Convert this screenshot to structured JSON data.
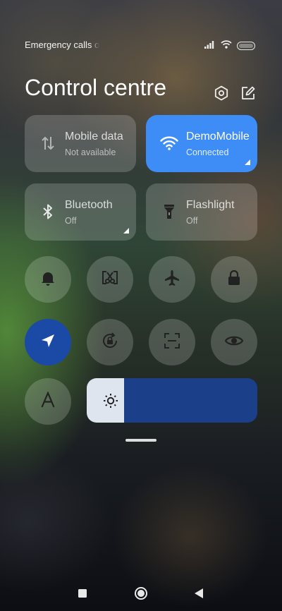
{
  "status_bar": {
    "carrier_text": "Emergency calls only",
    "icons": [
      "signal-icon",
      "wifi-icon",
      "battery-icon"
    ]
  },
  "header": {
    "title": "Control centre",
    "icons": [
      "settings-icon",
      "edit-icon"
    ]
  },
  "tiles": [
    {
      "label": "Mobile data",
      "status": "Not available",
      "icon": "mobile-data-icon",
      "active": false
    },
    {
      "label": "DemoMobile",
      "status": "Connected",
      "icon": "wifi-icon",
      "active": true
    },
    {
      "label": "Bluetooth",
      "status": "Off",
      "icon": "bluetooth-icon",
      "active": false
    },
    {
      "label": "Flashlight",
      "status": "Off",
      "icon": "flashlight-icon",
      "active": false
    }
  ],
  "toggles": [
    {
      "icon": "bell-icon",
      "active": false
    },
    {
      "icon": "screenshot-icon",
      "active": false
    },
    {
      "icon": "airplane-icon",
      "active": false
    },
    {
      "icon": "lock-icon",
      "active": false
    },
    {
      "icon": "location-icon",
      "active": true
    },
    {
      "icon": "rotation-lock-icon",
      "active": false
    },
    {
      "icon": "scanner-icon",
      "active": false
    },
    {
      "icon": "eye-icon",
      "active": false
    },
    {
      "icon": "auto-brightness-icon",
      "active": false
    }
  ],
  "brightness": {
    "level": 0.22,
    "icon": "sun-icon"
  },
  "colors": {
    "accent": "#3e8df7",
    "active_toggle": "#1a4aa5",
    "slider": "#1c3f8a"
  },
  "navigation": [
    "recents-icon",
    "home-icon",
    "back-icon"
  ]
}
